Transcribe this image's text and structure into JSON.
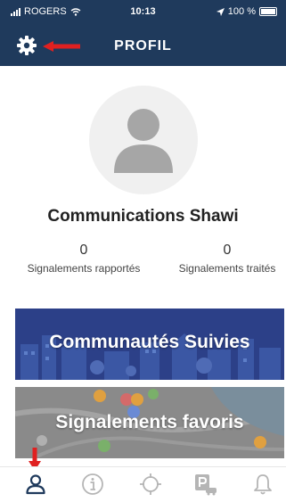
{
  "status_bar": {
    "carrier": "ROGERS",
    "time": "10:13",
    "battery": "100 %"
  },
  "header": {
    "title": "PROFIL"
  },
  "profile": {
    "name": "Communications Shawi",
    "stats": [
      {
        "value": "0",
        "label": "Signalements rapportés"
      },
      {
        "value": "0",
        "label": "Signalements traités"
      }
    ]
  },
  "cards": [
    {
      "label": "Communautés Suivies"
    },
    {
      "label": "Signalements favoris"
    }
  ],
  "tab_bar": {
    "tabs": [
      "profile-icon",
      "info-icon",
      "target-icon",
      "parking-icon",
      "bell-icon"
    ],
    "active_index": 0
  },
  "colors": {
    "header_bg": "#1f3a5c",
    "annotation_arrow": "#e02020",
    "active_tab": "#1f3a5c",
    "inactive_tab": "#b5b5b5"
  }
}
